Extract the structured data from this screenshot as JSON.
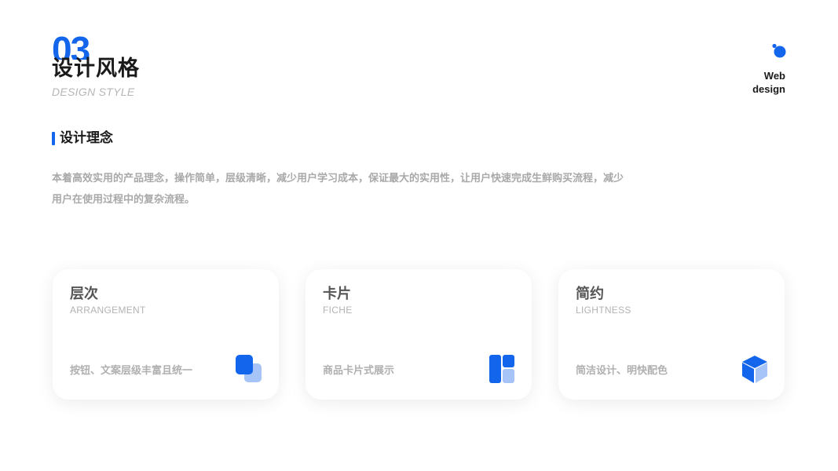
{
  "header": {
    "section_number": "03",
    "title": "设计风格",
    "subtitle": "DESIGN STYLE"
  },
  "brand": {
    "line1": "Web",
    "line2": "design"
  },
  "section": {
    "heading": "设计理念",
    "paragraph": "本着高效实用的产品理念，操作简单，层级清晰，减少用户学习成本，保证最大的实用性，让用户快速完成生鲜购买流程，减少用户在使用过程中的复杂流程。"
  },
  "cards": [
    {
      "title": "层次",
      "subtitle": "ARRANGEMENT",
      "desc": "按钮、文案层级丰富且统一",
      "icon": "layers-icon"
    },
    {
      "title": "卡片",
      "subtitle": "FICHE",
      "desc": "商品卡片式展示",
      "icon": "card-layout-icon"
    },
    {
      "title": "简约",
      "subtitle": "LIGHTNESS",
      "desc": "简洁设计、明快配色",
      "icon": "cube-icon"
    }
  ],
  "colors": {
    "accent": "#1366ec",
    "accent_light": "#a6c4f8",
    "text_dark": "#1a1a1a",
    "text_muted": "#a9a9a9"
  }
}
